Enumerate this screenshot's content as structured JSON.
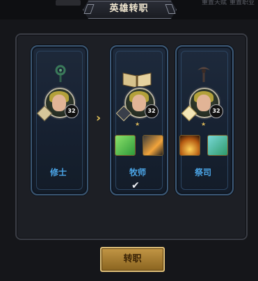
{
  "header": {
    "title": "英雄转职",
    "right_hint_1": "重置天赋",
    "right_hint_2": "重置职业"
  },
  "classes": [
    {
      "name": "修士",
      "level": "32",
      "star_count": 0,
      "selected": false
    },
    {
      "name": "牧师",
      "level": "32",
      "star_count": 1,
      "selected": true
    },
    {
      "name": "祭司",
      "level": "32",
      "star_count": 1,
      "selected": false
    }
  ],
  "confirm_button": {
    "label": "转职"
  },
  "colors": {
    "accent_label": "#4ba6e8",
    "gold": "#c29645",
    "panel_border": "#3d5a78"
  },
  "icons": {
    "arrow": "chevron-right",
    "selected_mark": "checkmark"
  }
}
